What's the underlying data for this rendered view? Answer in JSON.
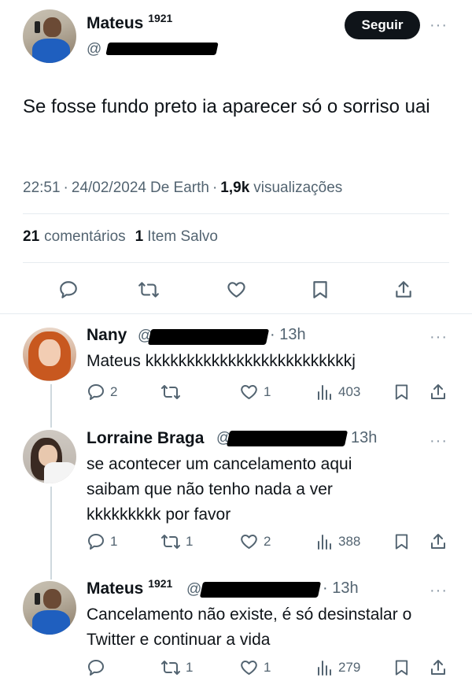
{
  "tweet": {
    "author": {
      "name": "Mateus",
      "badge": "1921",
      "handle_prefix": "@",
      "follow_label": "Seguir"
    },
    "text": "Se fosse fundo preto ia aparecer só o sorriso uai",
    "meta": {
      "time": "22:51",
      "date": "24/02/2024",
      "source": "De Earth",
      "views_count": "1,9k",
      "views_label": "visualizações"
    },
    "stats": {
      "comments_count": "21",
      "comments_label": "comentários",
      "saves_count": "1",
      "saves_label": "Item Salvo"
    }
  },
  "replies": [
    {
      "name": "Nany",
      "badge": "",
      "handle_prefix": "@",
      "time": "· 13h",
      "text": "Mateus kkkkkkkkkkkkkkkkkkkkkkkkkj",
      "replies": "2",
      "retweets": "",
      "likes": "1",
      "views": "403"
    },
    {
      "name": "Lorraine Braga",
      "badge": "",
      "handle_prefix": "@",
      "time": "13h",
      "text": "se acontecer um cancelamento aqui saibam que não tenho nada a ver kkkkkkkkk por favor",
      "replies": "1",
      "retweets": "1",
      "likes": "2",
      "views": "388"
    },
    {
      "name": "Mateus",
      "badge": "1921",
      "handle_prefix": "@",
      "time": "· 13h",
      "text": "Cancelamento não existe, é só desinstalar o Twitter e continuar a vida",
      "replies": "",
      "retweets": "1",
      "likes": "1",
      "views": "279"
    }
  ],
  "icons": [
    "reply-icon",
    "retweet-icon",
    "like-icon",
    "bookmark-icon",
    "share-icon",
    "views-icon",
    "more-icon"
  ]
}
